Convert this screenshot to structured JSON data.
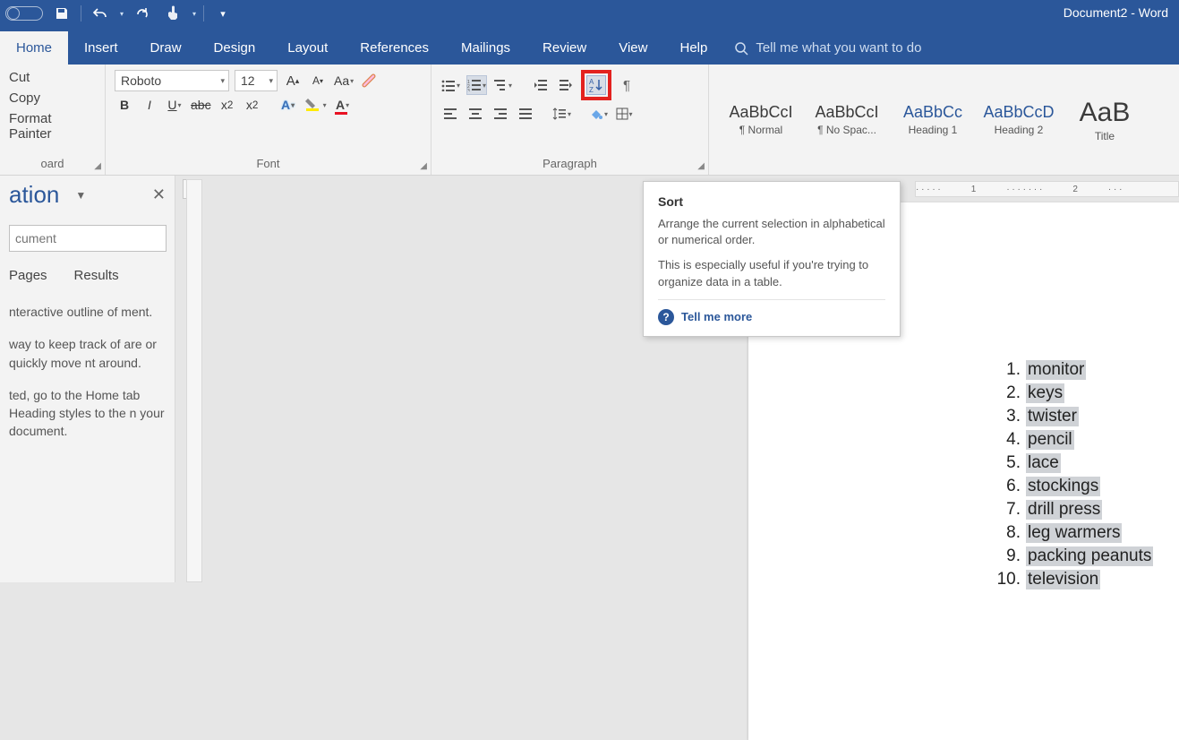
{
  "window": {
    "title": "Document2  -  Word"
  },
  "tabs": [
    "Home",
    "Insert",
    "Draw",
    "Design",
    "Layout",
    "References",
    "Mailings",
    "Review",
    "View",
    "Help"
  ],
  "active_tab": "Home",
  "tellme_placeholder": "Tell me what you want to do",
  "clipboard": {
    "cut": "Cut",
    "copy": "Copy",
    "format_painter": "Format Painter",
    "group_label": "oard"
  },
  "font": {
    "name": "Roboto",
    "size": "12",
    "group_label": "Font"
  },
  "paragraph": {
    "group_label": "Paragraph"
  },
  "styles": [
    {
      "preview": "AaBbCcI",
      "name": "¶ Normal"
    },
    {
      "preview": "AaBbCcI",
      "name": "¶ No Spac..."
    },
    {
      "preview": "AaBbCc",
      "name": "Heading 1",
      "accent": true
    },
    {
      "preview": "AaBbCcD",
      "name": "Heading 2",
      "accent": true
    },
    {
      "preview": "AaB",
      "name": "Title",
      "large": true
    }
  ],
  "tooltip": {
    "title": "Sort",
    "line1": "Arrange the current selection in alphabetical or numerical order.",
    "line2": "This is especially useful if you're trying to organize data in a table.",
    "link": "Tell me more"
  },
  "nav": {
    "title": "ation",
    "search_placeholder": "cument",
    "tabs": [
      "Pages",
      "Results"
    ],
    "body1": "nteractive outline of ment.",
    "body2": "way to keep track of are or quickly move nt around.",
    "body3": "ted, go to the Home tab Heading styles to the n your document."
  },
  "ruler_marks": [
    "1",
    "2"
  ],
  "list_items": [
    "monitor",
    "keys",
    "twister",
    "pencil",
    "lace",
    "stockings",
    "drill press",
    "leg warmers",
    "packing peanuts",
    "television"
  ]
}
